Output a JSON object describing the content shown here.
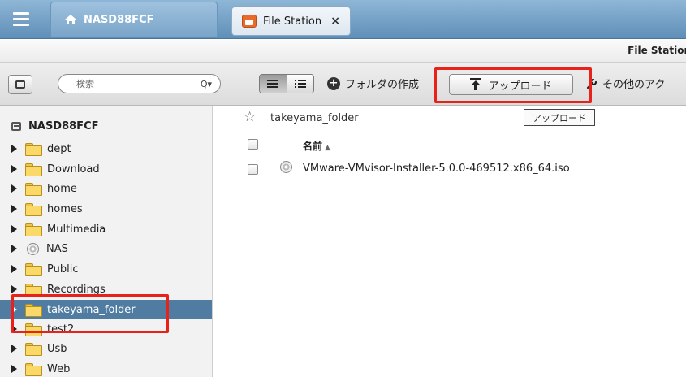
{
  "topbar": {
    "home_tab_label": "NASD88FCF",
    "app_tab_label": "File Station",
    "close_glyph": "×"
  },
  "title_strip": {
    "title": "File Station"
  },
  "toolbar": {
    "search_placeholder": "検索",
    "search_glyph": "Q▾",
    "new_folder_label": "フォルダの作成",
    "upload_label": "アップロード",
    "other_actions_label": "その他のアク"
  },
  "tooltip": {
    "text": "アップロード"
  },
  "sidebar": {
    "root_label": "NASD88FCF",
    "items": [
      {
        "label": "dept",
        "icon": "folder-icon",
        "selected": false
      },
      {
        "label": "Download",
        "icon": "folder-icon",
        "selected": false
      },
      {
        "label": "home",
        "icon": "folder-icon",
        "selected": false
      },
      {
        "label": "homes",
        "icon": "folder-icon",
        "selected": false
      },
      {
        "label": "Multimedia",
        "icon": "folder-icon",
        "selected": false
      },
      {
        "label": "NAS",
        "icon": "disc-icon",
        "selected": false
      },
      {
        "label": "Public",
        "icon": "folder-icon",
        "selected": false
      },
      {
        "label": "Recordings",
        "icon": "folder-icon",
        "selected": false
      },
      {
        "label": "takeyama_folder",
        "icon": "folder-icon",
        "selected": true
      },
      {
        "label": "test2",
        "icon": "folder-icon",
        "selected": false
      },
      {
        "label": "Usb",
        "icon": "folder-icon",
        "selected": false
      },
      {
        "label": "Web",
        "icon": "folder-icon",
        "selected": false
      }
    ]
  },
  "main": {
    "current_path": "takeyama_folder",
    "column_name": "名前",
    "sort_glyph": "▲",
    "files": [
      {
        "name": "VMware-VMvisor-Installer-5.0.0-469512.x86_64.iso",
        "icon": "disc-icon"
      }
    ]
  },
  "colors": {
    "highlight": "#e8221b",
    "selected_row": "#4f7ca0",
    "topbar": "#5f8fb8"
  }
}
